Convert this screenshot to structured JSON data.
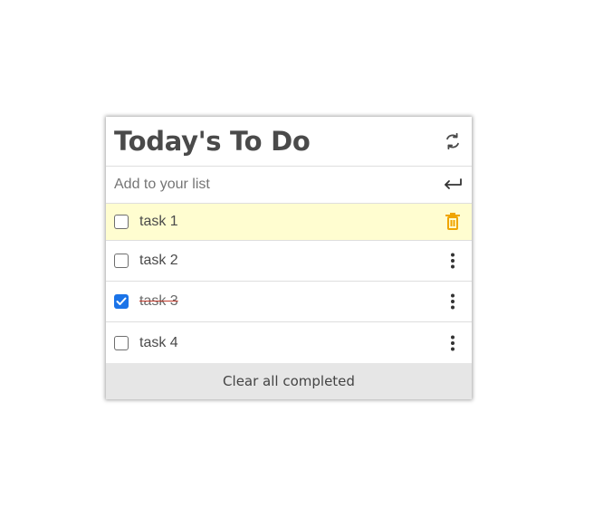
{
  "header": {
    "title": "Today's To Do",
    "refresh_icon": "refresh-icon"
  },
  "add": {
    "placeholder": "Add to your list",
    "submit_icon": "enter-arrow-icon"
  },
  "tasks": [
    {
      "label": "task 1",
      "completed": false,
      "highlighted": true,
      "action_icon": "trash-icon"
    },
    {
      "label": "task 2",
      "completed": false,
      "highlighted": false,
      "action_icon": "more-vertical-icon"
    },
    {
      "label": "task 3",
      "completed": true,
      "highlighted": false,
      "action_icon": "more-vertical-icon"
    },
    {
      "label": "task 4",
      "completed": false,
      "highlighted": false,
      "action_icon": "more-vertical-icon"
    }
  ],
  "footer": {
    "clear_label": "Clear all completed"
  },
  "colors": {
    "highlight": "#fffdd0",
    "trash": "#f0a500",
    "check": "#1a73e8",
    "strike": "#c0392b",
    "footer_bg": "#e6e6e6"
  }
}
